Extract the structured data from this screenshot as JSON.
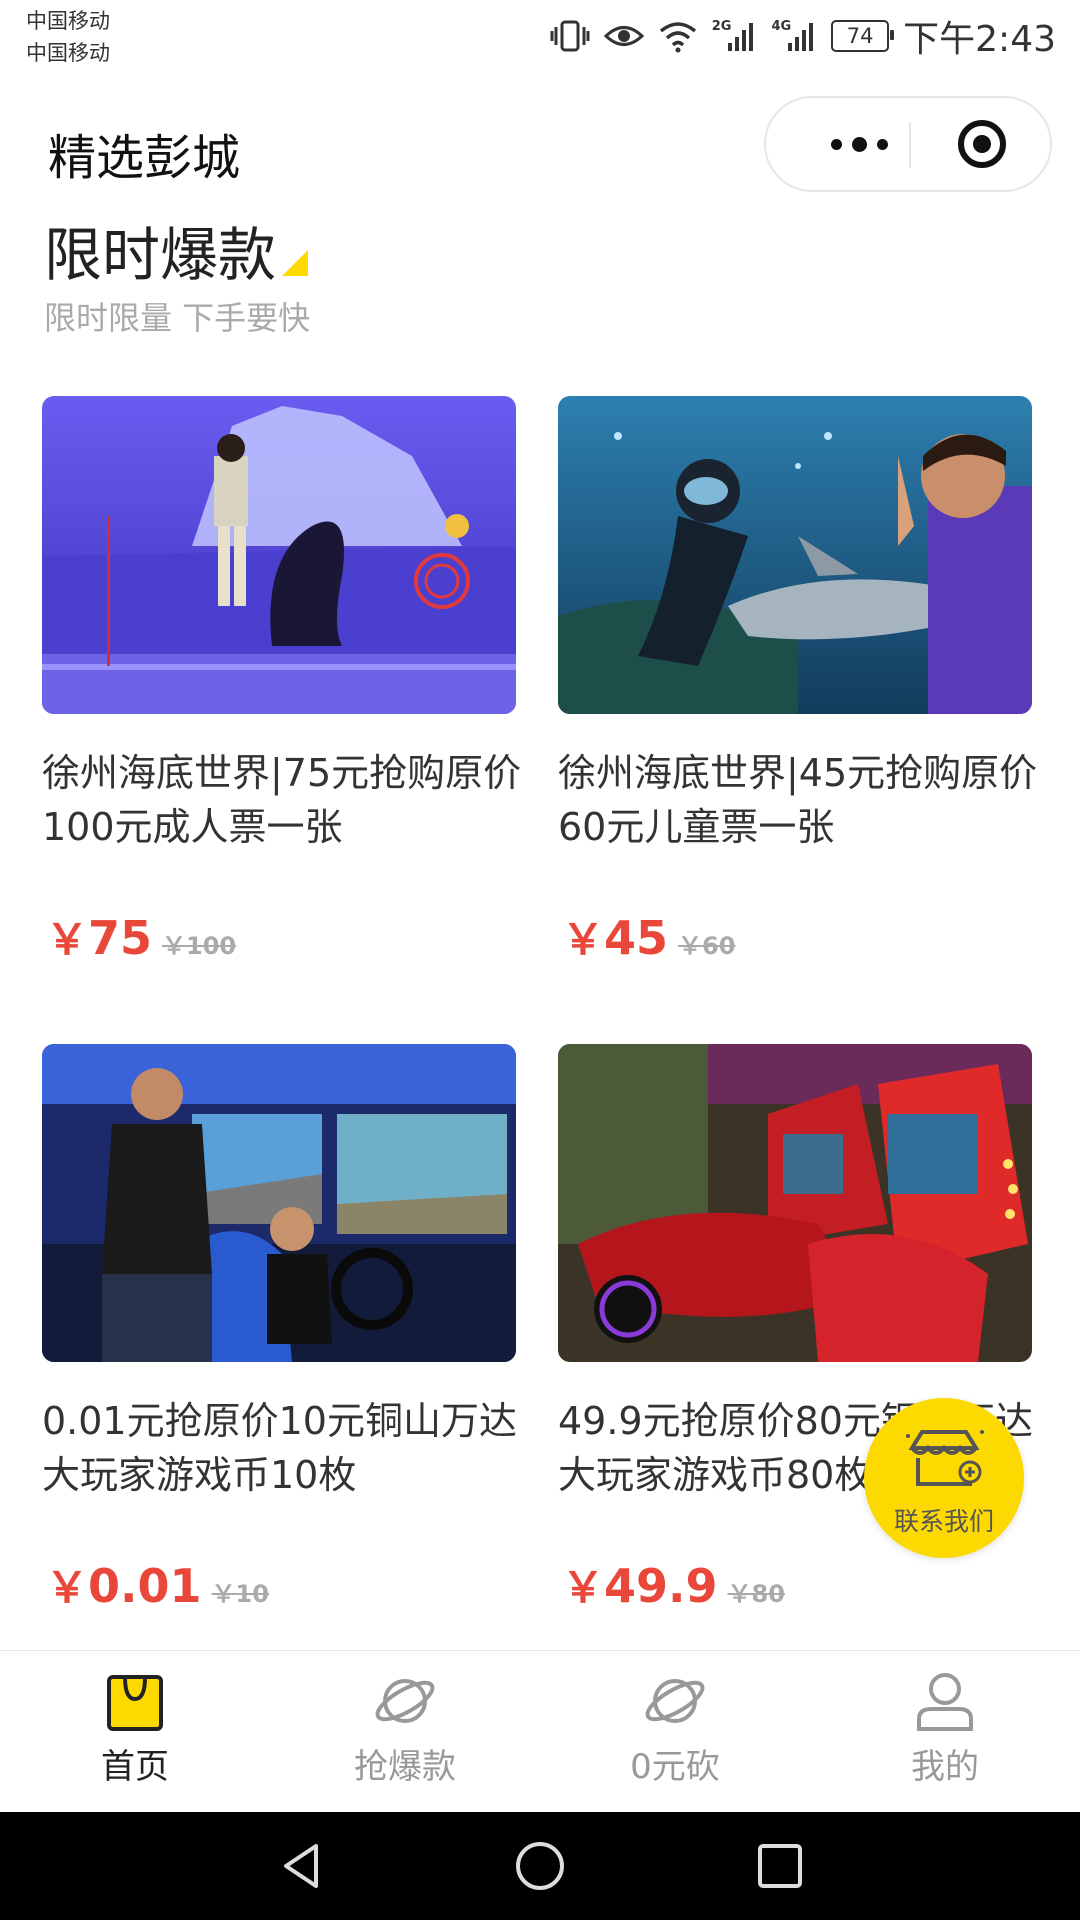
{
  "status_bar": {
    "carrier1": "中国移动",
    "carrier2": "中国移动",
    "signal1_tag": "2G",
    "signal2_tag": "4G",
    "battery": "74",
    "time": "下午2:43"
  },
  "navbar": {
    "title": "精选彭城"
  },
  "section": {
    "title": "限时爆款",
    "subtitle": "限时限量 下手要快",
    "accent_color": "#fcd900"
  },
  "products": [
    {
      "title": "徐州海底世界|75元抢购原价100元成人票一张",
      "price_symbol": "￥",
      "price": "75",
      "original_price": "￥100",
      "image": "sea-lion-show-photo"
    },
    {
      "title": "徐州海底世界|45元抢购原价60元儿童票一张",
      "price_symbol": "￥",
      "price": "45",
      "original_price": "￥60",
      "image": "shark-aquarium-photo"
    },
    {
      "title": "0.01元抢原价10元铜山万达大玩家游戏币10枚",
      "price_symbol": "￥",
      "price": "0.01",
      "original_price": "￥10",
      "image": "arcade-racing-photo"
    },
    {
      "title": "49.9元抢原价80元铜山万达大玩家游戏币80枚",
      "price_symbol": "￥",
      "price": "49.9",
      "original_price": "￥80",
      "image": "arcade-motorbike-photo"
    }
  ],
  "float_button": {
    "label": "联系我们",
    "icon": "shop-icon"
  },
  "tabbar": {
    "items": [
      {
        "label": "首页",
        "icon": "bag-icon",
        "active": true
      },
      {
        "label": "抢爆款",
        "icon": "planet-icon",
        "active": false
      },
      {
        "label": "0元砍",
        "icon": "planet-icon",
        "active": false
      },
      {
        "label": "我的",
        "icon": "user-icon",
        "active": false
      }
    ]
  },
  "colors": {
    "price": "#e8473a",
    "accent": "#fcd900",
    "muted": "#aaaaaa"
  }
}
